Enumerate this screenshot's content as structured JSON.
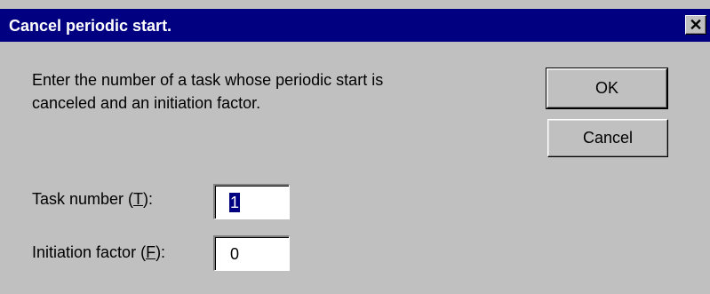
{
  "window": {
    "title": "Cancel periodic start.",
    "close_glyph": "✕"
  },
  "message": {
    "line1": "Enter the number of a task whose periodic start is",
    "line2": "canceled and an initiation factor."
  },
  "buttons": {
    "ok_label": "OK",
    "cancel_label": "Cancel"
  },
  "fields": {
    "task_number": {
      "label_before": "Task number (",
      "mnemonic": "T",
      "label_after": "):",
      "value": "1"
    },
    "initiation_factor": {
      "label_before": "Initiation factor (",
      "mnemonic": "F",
      "label_after": "):",
      "value": "0"
    }
  },
  "colors": {
    "titlebar": "#000080",
    "dialog_face": "#c0c0c0",
    "selection": "#000080"
  }
}
